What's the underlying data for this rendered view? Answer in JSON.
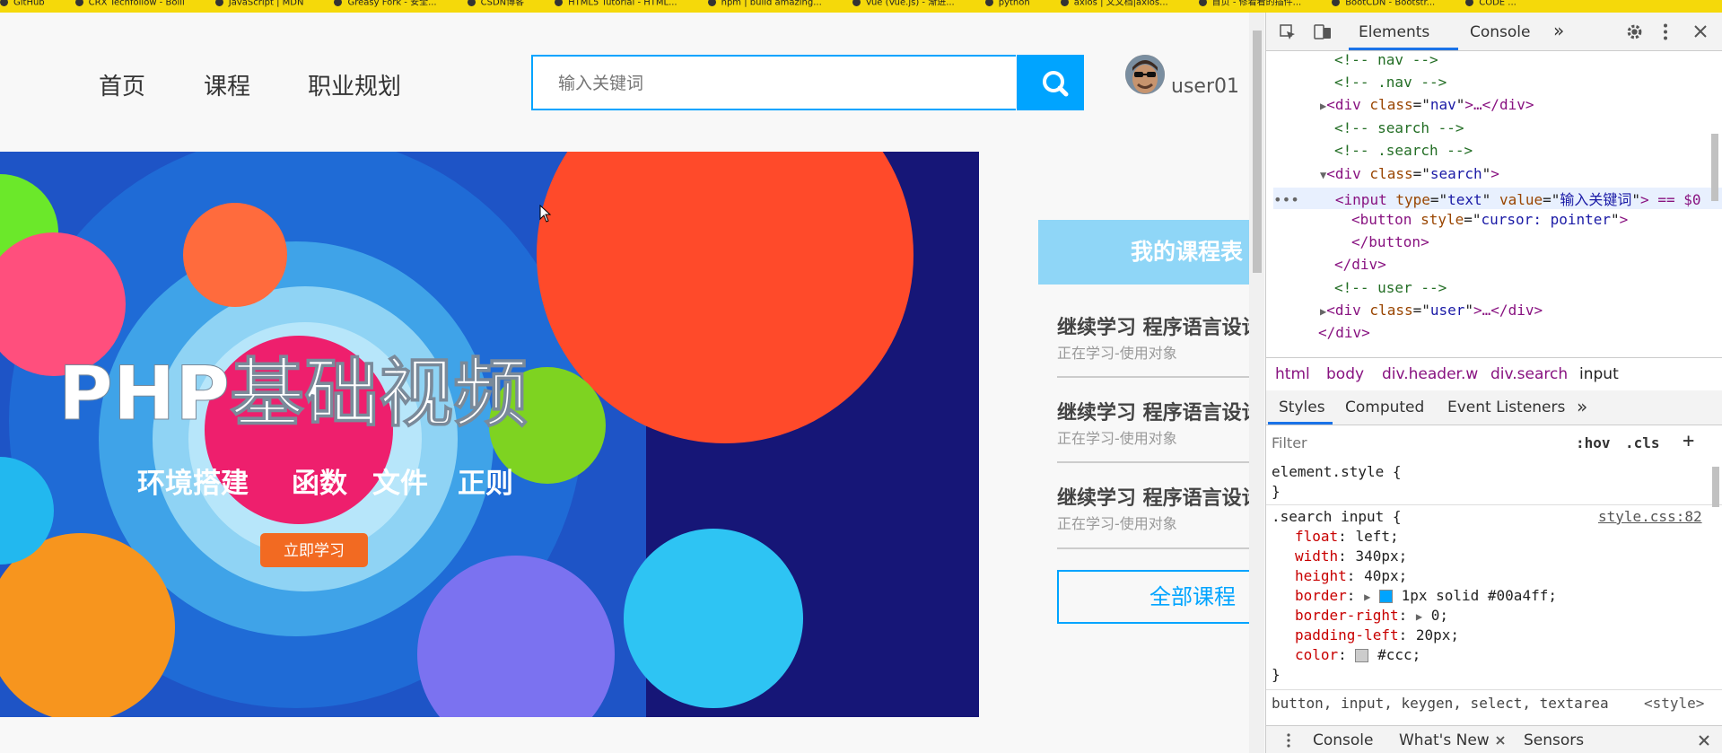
{
  "bookmarks": [
    "GitHub",
    "CRX Techfollow - Bolli",
    "JavaScript | MDN",
    "Greasy Fork - 安全...",
    "CSDN博客",
    "HTML5 Tutorial - HTML...",
    "npm | build amazing...",
    "Vue (Vue.js) - 渐进...",
    "python",
    "axios | 文文档|axios...",
    "首页 - 修着看的插件...",
    "BootCDN - Bootstr...",
    "CODE ..."
  ],
  "nav": {
    "home": "首页",
    "courses": "课程",
    "career": "职业规划"
  },
  "search": {
    "placeholder": "输入关键词"
  },
  "user": {
    "name": "user01"
  },
  "banner": {
    "title": "PHP基础视频",
    "subtitle_items": [
      "环境搭建",
      "函数",
      "文件",
      "正则"
    ],
    "cta": "立即学习"
  },
  "schedule": {
    "header": "我的课程表",
    "items": [
      {
        "title": "继续学习 程序语言设计",
        "status": "正在学习-使用对象"
      },
      {
        "title": "继续学习 程序语言设计",
        "status": "正在学习-使用对象"
      },
      {
        "title": "继续学习 程序语言设计",
        "status": "正在学习-使用对象"
      }
    ],
    "all_courses": "全部课程"
  },
  "devtools": {
    "tabs": [
      "Elements",
      "Console"
    ],
    "more": "»",
    "dom_lines": [
      {
        "kind": "comment",
        "text": "<!-- nav -->"
      },
      {
        "kind": "comment",
        "text": "<!--    .nav    -->"
      },
      {
        "kind": "collapsed",
        "tag": "div",
        "attr": "class",
        "val": "nav",
        "tail": ">…</div>"
      },
      {
        "kind": "comment",
        "text": "<!-- search -->"
      },
      {
        "kind": "comment",
        "text": "<!--    .search     -->"
      },
      {
        "kind": "open",
        "tag": "div",
        "attr": "class",
        "val": "search"
      },
      {
        "kind": "input",
        "text_a": "<input",
        "attr1": "type",
        "val1": "text",
        "attr2": "value",
        "val2": "输入关键词",
        "tail": "> == $0"
      },
      {
        "kind": "button",
        "attr": "style",
        "val": "cursor: pointer"
      },
      {
        "kind": "close",
        "text": "</button>"
      },
      {
        "kind": "close",
        "text": "</div>"
      },
      {
        "kind": "comment",
        "text": "<!-- user -->"
      },
      {
        "kind": "collapsed",
        "tag": "div",
        "attr": "class",
        "val": "user",
        "tail": ">…</div>"
      },
      {
        "kind": "close",
        "text": "</div>"
      }
    ],
    "breadcrumb": [
      "html",
      "body",
      "div.header.w",
      "div.search",
      "input"
    ],
    "styles_tabs": [
      "Styles",
      "Computed",
      "Event Listeners",
      "»"
    ],
    "filter": {
      "placeholder": "Filter",
      "hov": ":hov",
      "cls": ".cls",
      "plus": "+"
    },
    "element_style": {
      "selector": "element.style {",
      "close": "}"
    },
    "rule": {
      "selector": ".search input {",
      "source": "style.css:82",
      "props": [
        {
          "name": "float",
          "value": "left;"
        },
        {
          "name": "width",
          "value": "340px;"
        },
        {
          "name": "height",
          "value": "40px;"
        },
        {
          "name": "border",
          "value": "1px solid #00a4ff;",
          "swatch": "#00a4ff"
        },
        {
          "name": "border-right",
          "value": "0;"
        },
        {
          "name": "padding-left",
          "value": "20px;"
        },
        {
          "name": "color",
          "value": "#ccc;",
          "swatch": "#cccccc"
        }
      ],
      "close": "}"
    },
    "ua_rule": {
      "selector": "button, input, keygen, select, textarea",
      "source": "<style>"
    },
    "drawer": [
      "Console",
      "What's New",
      "Sensors"
    ]
  },
  "colors": {
    "accent": "#00a4ff",
    "schedule_header": "#8fd6f7",
    "bookmark_bar": "#f5d90a"
  }
}
